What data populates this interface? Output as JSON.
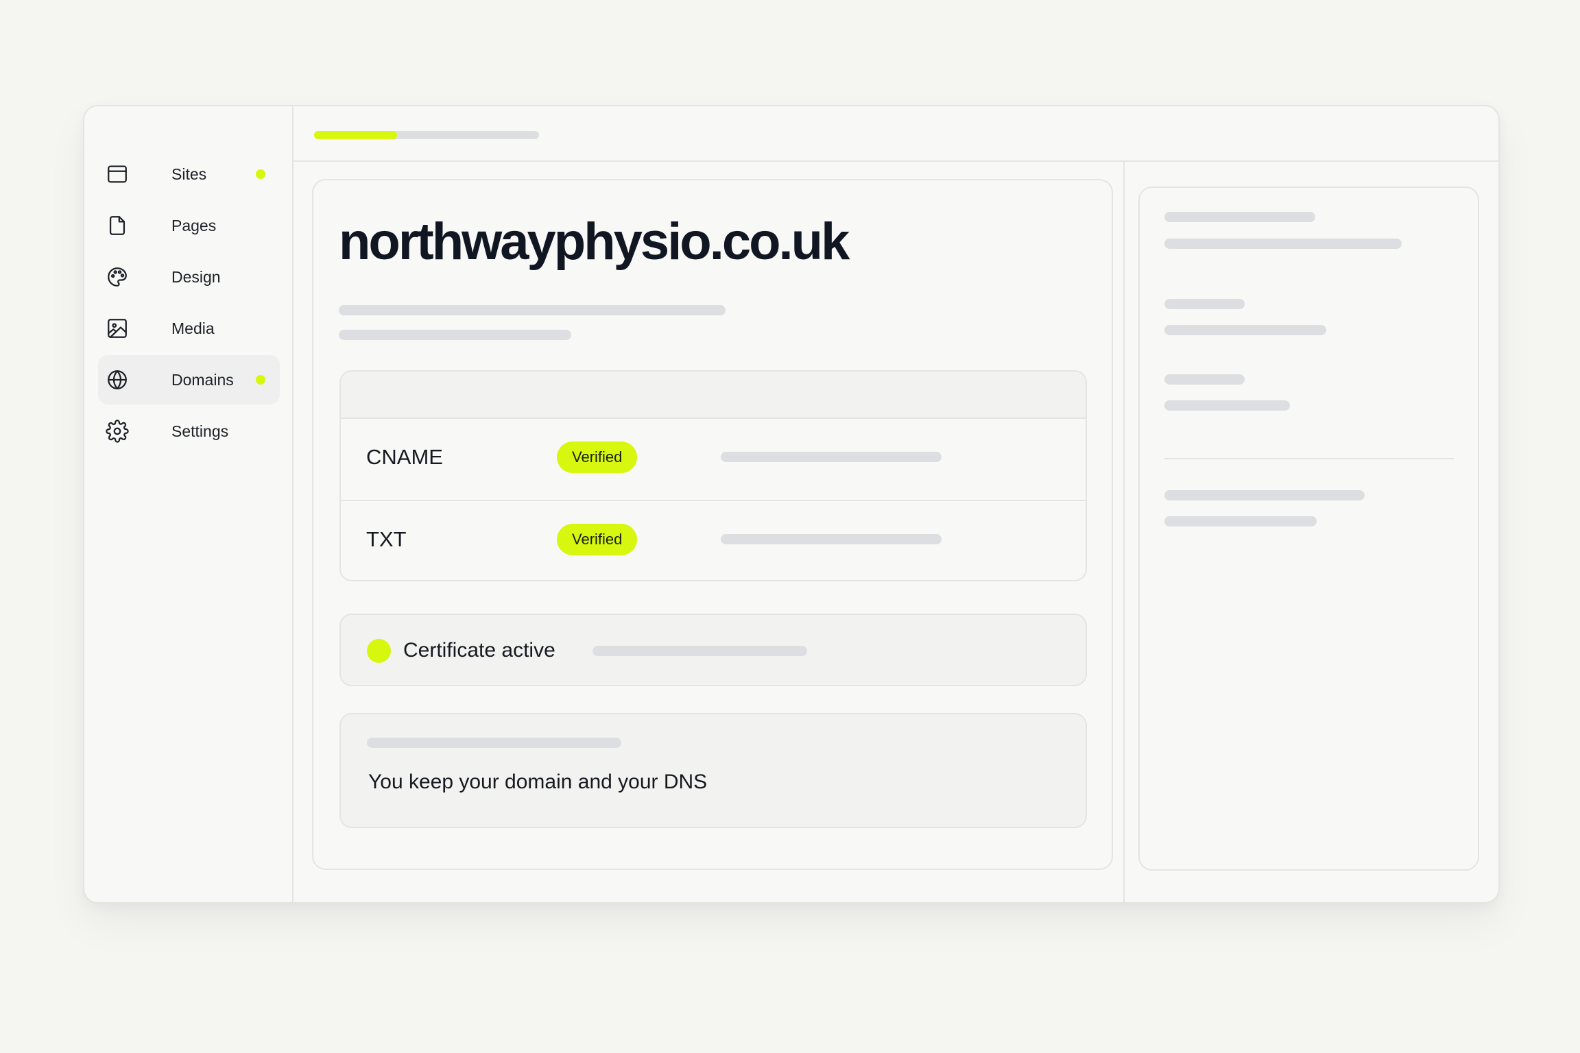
{
  "sidebar": {
    "items": [
      {
        "label": "Sites",
        "icon": "browser-window-icon",
        "dot": true,
        "active": false
      },
      {
        "label": "Pages",
        "icon": "page-icon",
        "dot": false,
        "active": false
      },
      {
        "label": "Design",
        "icon": "palette-icon",
        "dot": false,
        "active": false
      },
      {
        "label": "Media",
        "icon": "image-icon",
        "dot": false,
        "active": false
      },
      {
        "label": "Domains",
        "icon": "globe-icon",
        "dot": true,
        "active": true
      },
      {
        "label": "Settings",
        "icon": "gear-icon",
        "dot": false,
        "active": false
      }
    ]
  },
  "topbar": {
    "progress": 0.37
  },
  "main": {
    "domain": "northwayphysio.co.uk",
    "records": [
      {
        "type": "CNAME",
        "status": "Verified"
      },
      {
        "type": "TXT",
        "status": "Verified"
      }
    ],
    "certificate": {
      "label": "Certificate active"
    },
    "note": {
      "text": "You keep your domain and your DNS"
    }
  },
  "colors": {
    "accent": "#d7f70f",
    "background": "#f5f5f2",
    "skeleton": "#dcdee1",
    "border": "#e4e5e3",
    "text": "#15191f"
  }
}
